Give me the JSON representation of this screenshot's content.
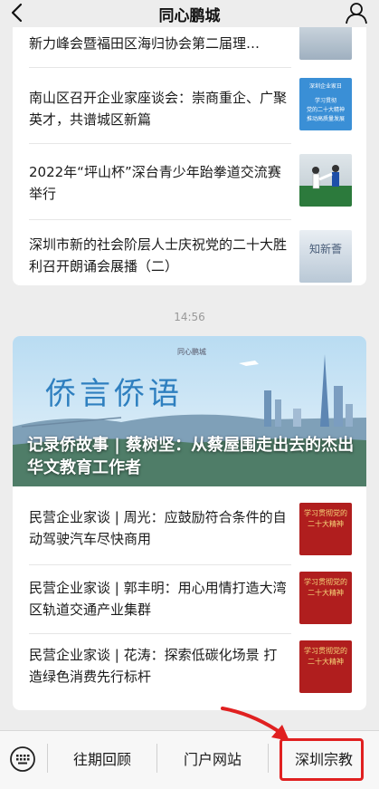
{
  "header": {
    "title": "同心鹏城"
  },
  "feed1": {
    "items": [
      {
        "title": "新力峰会暨福田区海归协会第二届理…"
      },
      {
        "title": "南山区召开企业家座谈会：崇商重企、广聚英才，共谱城区新篇",
        "thumb_text": [
          "深圳企业家日",
          "学习贯彻",
          "党的二十大精神",
          "推动高质量发展"
        ]
      },
      {
        "title": "2022年“坪山杯”深台青少年跆拳道交流赛举行"
      },
      {
        "title": "深圳市新的社会阶层人士庆祝党的二十大胜利召开朗诵会展播（二）",
        "thumb_text": "知新薈"
      }
    ]
  },
  "timestamp": "14:56",
  "feed2": {
    "hero": {
      "brand": "同心鹏城",
      "banner_text": "侨言侨语",
      "title": "记录侨故事 | 蔡树坚：从蔡屋围走出去的杰出华文教育工作者"
    },
    "items": [
      {
        "title": "民营企业家谈 | 周光：应鼓励符合条件的自动驾驶汽车尽快商用",
        "thumb_text": "学习贯彻党的二十大精神"
      },
      {
        "title": "民营企业家谈 | 郭丰明：用心用情打造大湾区轨道交通产业集群",
        "thumb_text": "学习贯彻党的二十大精神"
      },
      {
        "title": "民营企业家谈 | 花涛：探索低碳化场景 打造绿色消费先行标杆",
        "thumb_text": "学习贯彻党的二十大精神"
      }
    ]
  },
  "bottom_menu": {
    "keyboard_icon": "keyboard-icon",
    "items": [
      {
        "label": "往期回顾"
      },
      {
        "label": "门户网站"
      },
      {
        "label": "深圳宗教"
      }
    ]
  },
  "colors": {
    "highlight": "#e02020",
    "party_red": "#b01e1e"
  }
}
